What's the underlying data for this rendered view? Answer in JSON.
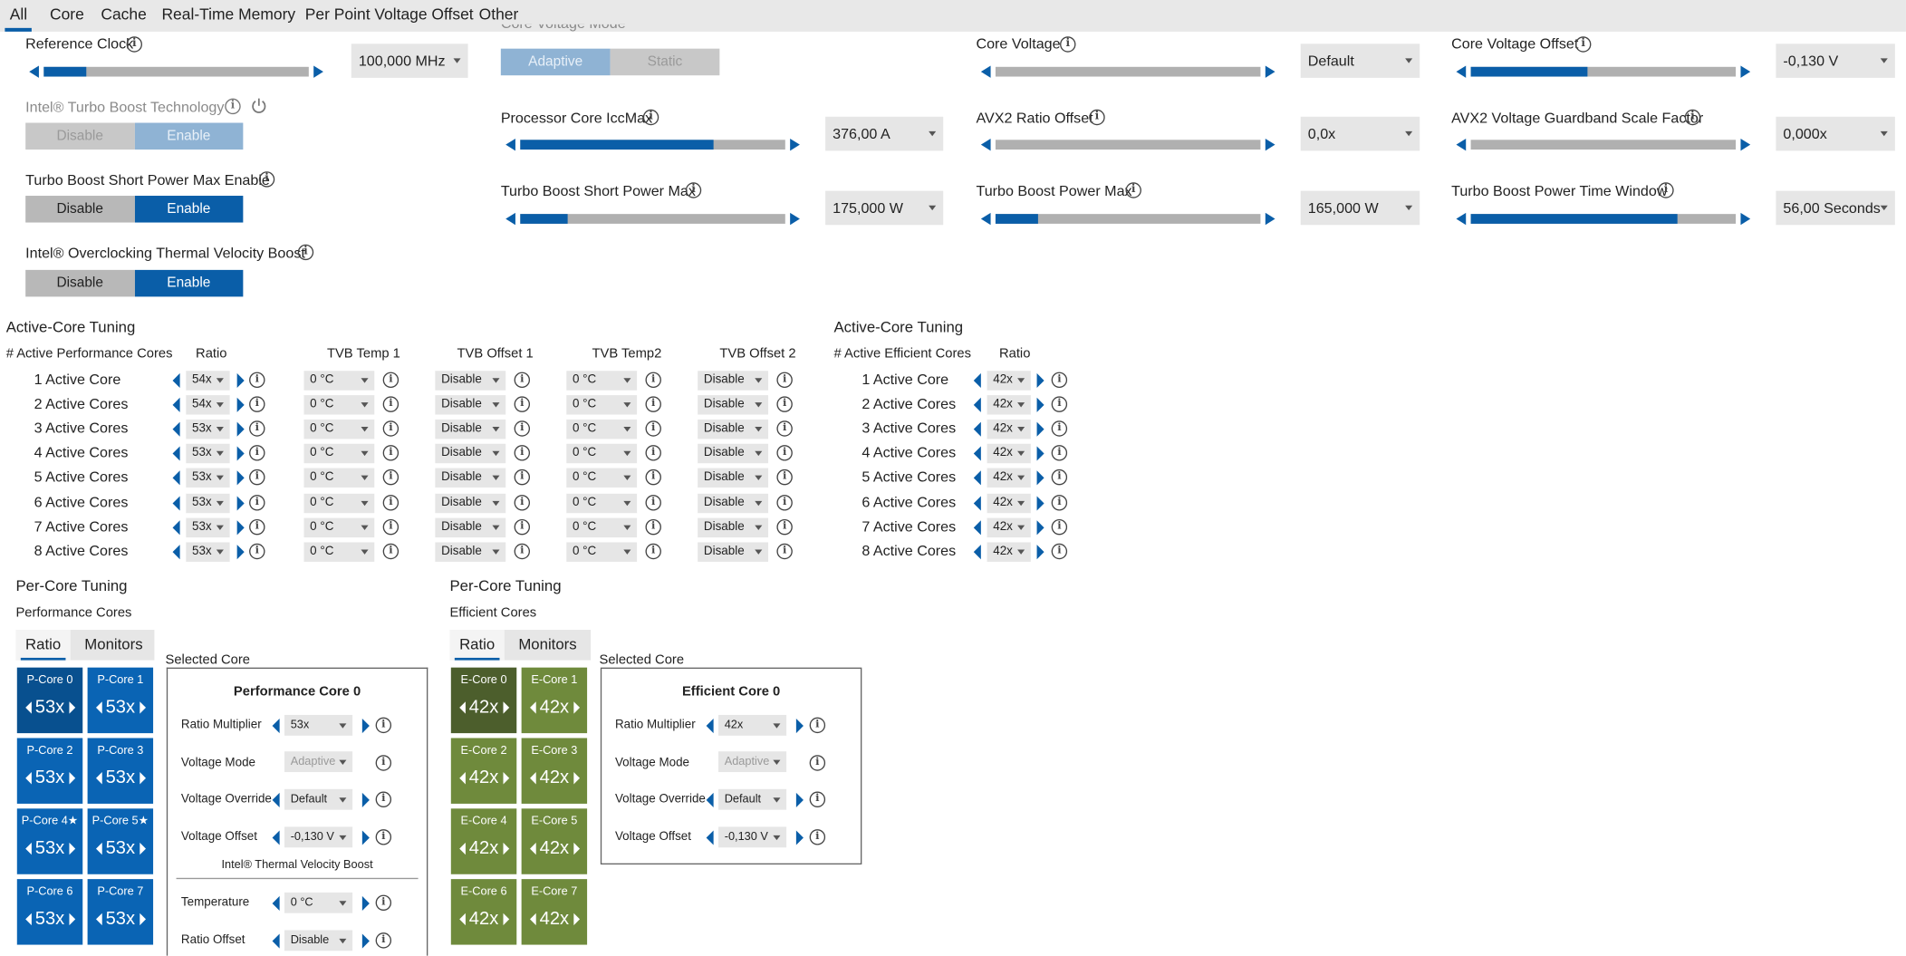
{
  "tabs": [
    "All",
    "Core",
    "Cache",
    "Real-Time Memory",
    "Per Point Voltage Offset",
    "Other"
  ],
  "active_tab": "All",
  "colors": {
    "accent": "#0a5ea8",
    "perf_tile": "#0a64b4",
    "perf_tile_selected": "#08508f",
    "eff_tile": "#6f8a3c",
    "eff_tile_selected": "#4c5e2c"
  },
  "top": {
    "reference_clock": {
      "label": "Reference Clock",
      "value": "100,000 MHz",
      "fill_pct": 16
    },
    "turbo_boost_tech": {
      "label": "Intel® Turbo Boost Technology",
      "off": "Disable",
      "on": "Enable",
      "selected": "Enable",
      "disabled": true
    },
    "short_power_max_enable": {
      "label": "Turbo Boost Short Power Max Enable",
      "off": "Disable",
      "on": "Enable",
      "selected": "Enable"
    },
    "otvb": {
      "label": "Intel® Overclocking Thermal Velocity Boost",
      "off": "Disable",
      "on": "Enable",
      "selected": "Enable"
    },
    "core_voltage_mode": {
      "label": "Core Voltage Mode",
      "on": "Adaptive",
      "off": "Static",
      "selected": "Adaptive",
      "disabled": true
    },
    "iccmax": {
      "label": "Processor Core IccMax",
      "value": "376,00 A",
      "fill_pct": 73
    },
    "short_power_max": {
      "label": "Turbo Boost Short Power Max",
      "value": "175,000 W",
      "fill_pct": 18
    },
    "core_voltage": {
      "label": "Core Voltage",
      "value": "Default",
      "fill_pct": 0
    },
    "avx2_ratio": {
      "label": "AVX2 Ratio Offset",
      "value": "0,0x",
      "fill_pct": 0
    },
    "power_max": {
      "label": "Turbo Boost Power Max",
      "value": "165,000 W",
      "fill_pct": 16
    },
    "core_voltage_offset": {
      "label": "Core Voltage Offset",
      "value": "-0,130 V",
      "fill_pct": 44
    },
    "avx2_guardband": {
      "label": "AVX2 Voltage Guardband Scale Factor",
      "value": "0,000x",
      "fill_pct": 0
    },
    "power_time_window": {
      "label": "Turbo Boost Power Time Window",
      "value": "56,00 Seconds",
      "fill_pct": 78
    }
  },
  "active_perf": {
    "title": "Active-Core Tuning",
    "headers": [
      "# Active Performance Cores",
      "Ratio",
      "TVB Temp 1",
      "TVB Offset 1",
      "TVB Temp2",
      "TVB Offset 2"
    ],
    "rows": [
      {
        "label": "1 Active Core",
        "ratio": "54x",
        "t1": "0 °C",
        "o1": "Disable",
        "t2": "0 °C",
        "o2": "Disable"
      },
      {
        "label": "2 Active Cores",
        "ratio": "54x",
        "t1": "0 °C",
        "o1": "Disable",
        "t2": "0 °C",
        "o2": "Disable"
      },
      {
        "label": "3 Active Cores",
        "ratio": "53x",
        "t1": "0 °C",
        "o1": "Disable",
        "t2": "0 °C",
        "o2": "Disable"
      },
      {
        "label": "4 Active Cores",
        "ratio": "53x",
        "t1": "0 °C",
        "o1": "Disable",
        "t2": "0 °C",
        "o2": "Disable"
      },
      {
        "label": "5 Active Cores",
        "ratio": "53x",
        "t1": "0 °C",
        "o1": "Disable",
        "t2": "0 °C",
        "o2": "Disable"
      },
      {
        "label": "6 Active Cores",
        "ratio": "53x",
        "t1": "0 °C",
        "o1": "Disable",
        "t2": "0 °C",
        "o2": "Disable"
      },
      {
        "label": "7 Active Cores",
        "ratio": "53x",
        "t1": "0 °C",
        "o1": "Disable",
        "t2": "0 °C",
        "o2": "Disable"
      },
      {
        "label": "8 Active Cores",
        "ratio": "53x",
        "t1": "0 °C",
        "o1": "Disable",
        "t2": "0 °C",
        "o2": "Disable"
      }
    ]
  },
  "active_eff": {
    "title": "Active-Core Tuning",
    "headers": [
      "# Active Efficient Cores",
      "Ratio"
    ],
    "rows": [
      {
        "label": "1 Active Core",
        "ratio": "42x"
      },
      {
        "label": "2 Active Cores",
        "ratio": "42x"
      },
      {
        "label": "3 Active Cores",
        "ratio": "42x"
      },
      {
        "label": "4 Active Cores",
        "ratio": "42x"
      },
      {
        "label": "5 Active Cores",
        "ratio": "42x"
      },
      {
        "label": "6 Active Cores",
        "ratio": "42x"
      },
      {
        "label": "7 Active Cores",
        "ratio": "42x"
      },
      {
        "label": "8 Active Cores",
        "ratio": "42x"
      }
    ]
  },
  "per_core_perf": {
    "title": "Per-Core Tuning",
    "subtitle": "Performance Cores",
    "tabs": [
      "Ratio",
      "Monitors"
    ],
    "tiles": [
      {
        "name": "P-Core 0",
        "value": "53x"
      },
      {
        "name": "P-Core 1",
        "value": "53x"
      },
      {
        "name": "P-Core 2",
        "value": "53x"
      },
      {
        "name": "P-Core 3",
        "value": "53x"
      },
      {
        "name": "P-Core 4★",
        "value": "53x"
      },
      {
        "name": "P-Core 5★",
        "value": "53x"
      },
      {
        "name": "P-Core 6",
        "value": "53x"
      },
      {
        "name": "P-Core 7",
        "value": "53x"
      }
    ],
    "selected_label": "Selected Core",
    "panel": {
      "title": "Performance Core 0",
      "ratio_label": "Ratio Multiplier",
      "ratio": "53x",
      "vmode_label": "Voltage Mode",
      "vmode": "Adaptive",
      "vover_label": "Voltage Override",
      "vover": "Default",
      "voff_label": "Voltage Offset",
      "voff": "-0,130 V",
      "tvb_title": "Intel® Thermal Velocity Boost",
      "temp_label": "Temperature",
      "temp": "0 °C",
      "roff_label": "Ratio Offset",
      "roff": "Disable"
    }
  },
  "per_core_eff": {
    "title": "Per-Core Tuning",
    "subtitle": "Efficient Cores",
    "tabs": [
      "Ratio",
      "Monitors"
    ],
    "tiles": [
      {
        "name": "E-Core 0",
        "value": "42x"
      },
      {
        "name": "E-Core 1",
        "value": "42x"
      },
      {
        "name": "E-Core 2",
        "value": "42x"
      },
      {
        "name": "E-Core 3",
        "value": "42x"
      },
      {
        "name": "E-Core 4",
        "value": "42x"
      },
      {
        "name": "E-Core 5",
        "value": "42x"
      },
      {
        "name": "E-Core 6",
        "value": "42x"
      },
      {
        "name": "E-Core 7",
        "value": "42x"
      }
    ],
    "selected_label": "Selected Core",
    "panel": {
      "title": "Efficient Core 0",
      "ratio_label": "Ratio Multiplier",
      "ratio": "42x",
      "vmode_label": "Voltage Mode",
      "vmode": "Adaptive",
      "vover_label": "Voltage Override",
      "vover": "Default",
      "voff_label": "Voltage Offset",
      "voff": "-0,130 V"
    }
  }
}
